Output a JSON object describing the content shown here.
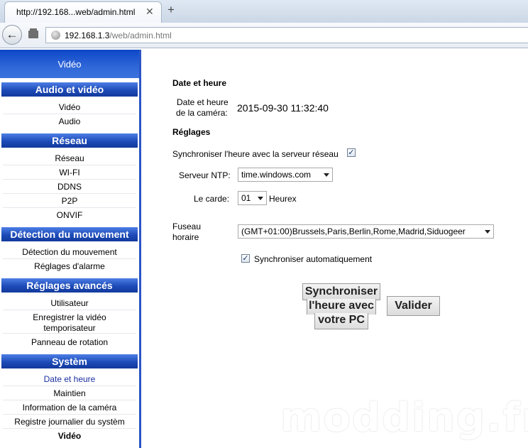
{
  "browser": {
    "tab_title": "http://192.168...web/admin.html",
    "url_host": "192.168.1.3",
    "url_path": "/web/admin.html"
  },
  "sidebar": {
    "top_label": "Vidéo",
    "sections": [
      {
        "title": "Audio et vidéo",
        "items": [
          "Vidéo",
          "Audio"
        ]
      },
      {
        "title": "Réseau",
        "items": [
          "Réseau",
          "WI-FI",
          "DDNS",
          "P2P",
          "ONVIF"
        ]
      },
      {
        "title": "Détection du mouvement",
        "items": [
          "Détection du mouvement",
          "Réglages d'alarme"
        ]
      },
      {
        "title": "Réglages avancés",
        "items": [
          "Utilisateur",
          "Enregistrer la vidéo temporisateur",
          "Panneau de rotation"
        ]
      },
      {
        "title": "Systèm",
        "items": [
          "Date et heure",
          "Maintien",
          "Information de la caméra",
          "Registre journalier du systèm",
          "Vidéo"
        ]
      }
    ]
  },
  "main": {
    "section_title": "Date et heure",
    "camera_time_label_1": "Date et heure",
    "camera_time_label_2": "de la caméra:",
    "camera_time_value": "2015-09-30 11:32:40",
    "settings_title": "Réglages",
    "sync_server_label": "Synchroniser l'heure avec la serveur réseau",
    "sync_server_checked": true,
    "ntp_label": "Serveur NTP:",
    "ntp_value": "time.windows.com",
    "interval_label": "Le carde:",
    "interval_value": "01",
    "interval_unit": "Heurex",
    "timezone_label_1": "Fuseau",
    "timezone_label_2": "horaire",
    "timezone_value": "(GMT+01:00)Brussels,Paris,Berlin,Rome,Madrid,Siduogeer",
    "auto_sync_label": "Synchroniser automatiquement",
    "auto_sync_checked": true,
    "sync_pc_button_1": "Synchroniser",
    "sync_pc_button_2": "l'heure avec",
    "sync_pc_button_3": "votre PC",
    "submit_button": "Valider"
  },
  "watermark": "modding.fr"
}
